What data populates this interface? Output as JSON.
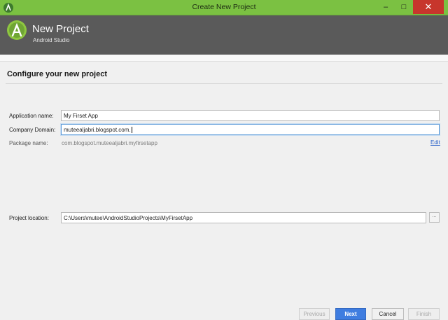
{
  "window": {
    "title": "Create New Project"
  },
  "header": {
    "title": "New Project",
    "subtitle": "Android Studio"
  },
  "section": {
    "title": "Configure your new project"
  },
  "form": {
    "app_name": {
      "label": "Application name:",
      "value": "My Firset App"
    },
    "company_domain": {
      "label": "Company Domain:",
      "value": "muteealjabri.blogspot.com."
    },
    "package_name": {
      "label": "Package name:",
      "value": "com.blogspot.muteealjabri.myfirsetapp",
      "edit_label": "Edit"
    },
    "project_location": {
      "label": "Project location:",
      "value": "C:\\Users\\mutee\\AndroidStudioProjects\\MyFirsetApp",
      "browse_label": "..."
    }
  },
  "footer": {
    "previous": "Previous",
    "next": "Next",
    "cancel": "Cancel",
    "finish": "Finish"
  },
  "colors": {
    "titlebar": "#7bc142",
    "header": "#5a5a5a",
    "accent": "#3f7de0",
    "link": "#2a62c9",
    "close": "#c7362c"
  },
  "icons": {
    "app": "android-studio-icon",
    "logo": "android-studio-logo",
    "minimize": "minimize-icon",
    "maximize": "maximize-icon",
    "close": "close-icon"
  }
}
